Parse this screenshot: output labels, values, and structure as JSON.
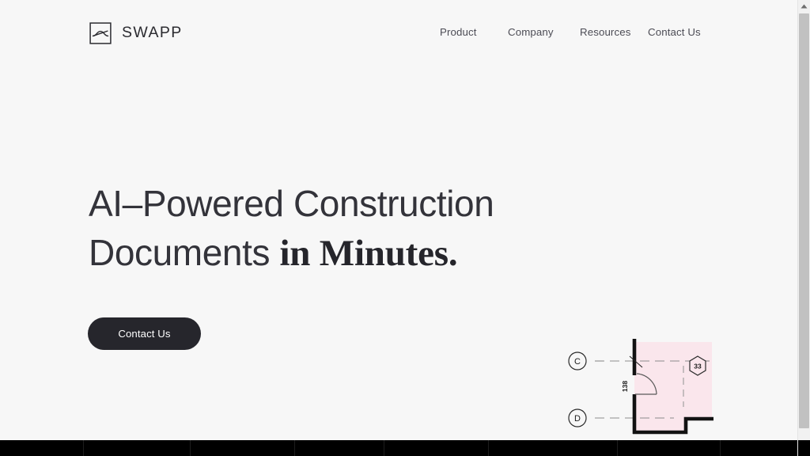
{
  "brand": {
    "name": "SWAPP",
    "logo_icon": "swapp-square-s-icon"
  },
  "nav": {
    "items": [
      {
        "label": "Product"
      },
      {
        "label": "Company"
      },
      {
        "label": "Resources"
      },
      {
        "label": "Contact Us"
      }
    ]
  },
  "hero": {
    "heading_line1": "AI–Powered Construction",
    "heading_line2_regular": "Documents ",
    "heading_line2_emphasis": "in Minutes.",
    "cta_label": "Contact Us"
  },
  "plan": {
    "grid_bubbles": [
      {
        "label": "C"
      },
      {
        "label": "D"
      }
    ],
    "dimension_label": "138",
    "room_tag": "33",
    "room_fill": "#fae6ec",
    "wall_color": "#121212"
  },
  "colors": {
    "page_background": "#f7f7f7",
    "text_primary": "#33333a",
    "text_nav": "#4c4c55",
    "button_background": "#26262c",
    "button_text": "#ffffff",
    "band_background": "#000000"
  },
  "scrollbar": {
    "up_arrow_icon": "chevron-up-icon"
  },
  "band": {
    "divider_positions": [
      105,
      240,
      372,
      485,
      617,
      780,
      910
    ]
  }
}
